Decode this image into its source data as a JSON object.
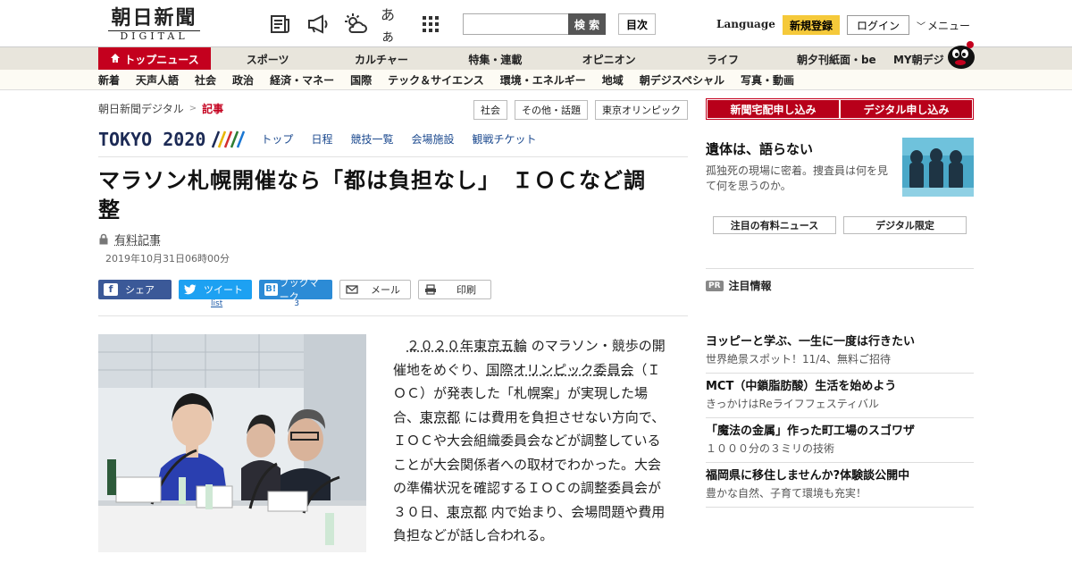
{
  "header": {
    "logo_kanji": "朝日新聞",
    "logo_latin": "DIGITAL",
    "icons": [
      "newspaper-icon",
      "megaphone-icon",
      "weather-icon",
      "font-size-icon",
      "grid-icon"
    ],
    "font_size_glyph": "あぁ",
    "search_placeholder": "",
    "search_button": "検 索",
    "mokuji_button": "目次",
    "language": "Language",
    "register_button": "新規登録",
    "login_button": "ログイン",
    "menu_label": "メニュー"
  },
  "nav": {
    "top_news": "トップニュース",
    "primary": [
      "スポーツ",
      "カルチャー",
      "特集・連載",
      "オピニオン",
      "ライフ",
      "朝夕刊紙面・be",
      "MY朝デジ"
    ],
    "secondary": [
      "新着",
      "天声人語",
      "社会",
      "政治",
      "経済・マネー",
      "国際",
      "テック＆サイエンス",
      "環境・エネルギー",
      "地域",
      "朝デジスペシャル",
      "写真・動画"
    ]
  },
  "breadcrumb": {
    "home": "朝日新聞デジタル",
    "sep": ">",
    "current": "記事"
  },
  "tags": [
    "社会",
    "その他・話題",
    "東京オリンピック"
  ],
  "tokyo": {
    "logo": "TOKYO 2020",
    "links": [
      "トップ",
      "日程",
      "競技一覧",
      "会場施設",
      "観戦チケット"
    ]
  },
  "article": {
    "headline_line1": "マラソン札幌開催なら「都は負担なし」　ＩＯＣなど調",
    "headline_line2": "整",
    "paid_label": "有料記事",
    "date": "2019年10月31日06時00分",
    "body_parts": [
      "２０２０年東京五輪",
      " のマラソン・競歩の開催地をめぐり、",
      "国際オリンピック委員会",
      "（ＩＯＣ）が発表した「札幌案」が実現した場合、",
      "東京都",
      " には費用を負担させない方向で、ＩＯＣや大会組織委員会などが調整していることが大会関係者への取材でわかった。大会の準備状況を確認するＩＯＣの調整委員会が３０日、",
      "東京都",
      " 内で始まり、会場問題や費用負担などが話し合われる。"
    ]
  },
  "share": {
    "facebook": "シェア",
    "twitter": "ツイート",
    "hatena": "ブックマーク",
    "hatena_mark": "B!",
    "mail": "メール",
    "print": "印刷",
    "twitter_count": "list",
    "hatena_count": "3"
  },
  "sidebar": {
    "subscribe_paper": "新聞宅配申し込み",
    "subscribe_digital": "デジタル申し込み",
    "feature_title": "遺体は、語らない",
    "feature_desc": "孤独死の現場に密着。捜査員は何を見て何を思うのか。",
    "btn_paid_news": "注目の有料ニュース",
    "btn_digital_only": "デジタル限定",
    "pr_badge": "PR",
    "pr_heading": "注目情報",
    "pr_items": [
      {
        "title": "ヨッピーと学ぶ、一生に一度は行きたい",
        "desc": "世界絶景スポット！11/4、無料ご招待"
      },
      {
        "title": "MCT（中鎖脂肪酸）生活を始めよう",
        "desc": "きっかけはReライフフェスティバル"
      },
      {
        "title": "「魔法の金属」作った町工場のスゴワザ",
        "desc": "１０００分の３ミリの技術"
      },
      {
        "title": "福岡県に移住しませんか?体験談公開中",
        "desc": "豊かな自然、子育て環境も充実！"
      }
    ]
  },
  "colors": {
    "brand_red": "#c4001e",
    "register_yellow": "#f5c93a",
    "facebook": "#3b5998",
    "twitter": "#1da1f2"
  }
}
